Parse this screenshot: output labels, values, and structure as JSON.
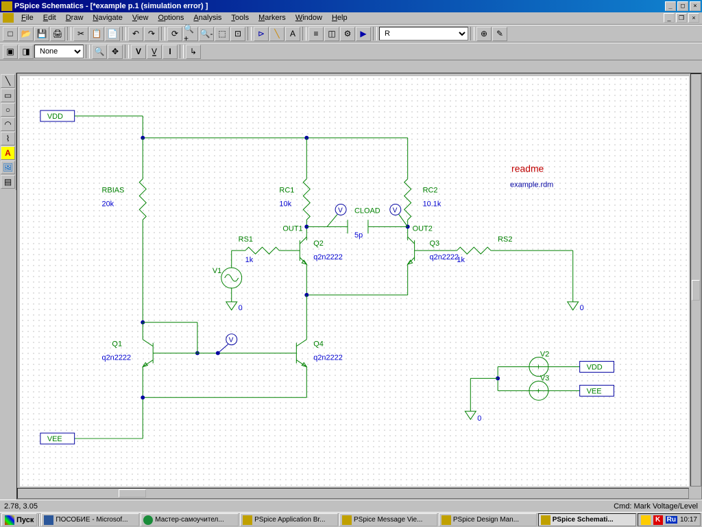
{
  "title": "PSpice Schematics - [*example  p.1  (simulation error) ]",
  "menu": [
    "File",
    "Edit",
    "Draw",
    "Navigate",
    "View",
    "Options",
    "Analysis",
    "Tools",
    "Markers",
    "Window",
    "Help"
  ],
  "toolbar1_combo": "R",
  "toolbar2_combo": "None",
  "schematic": {
    "ports": {
      "vdd1": "VDD",
      "vee1": "VEE",
      "vdd2": "VDD",
      "vee2": "VEE"
    },
    "readme_title": "readme",
    "readme_file": "example.rdm",
    "resistors": {
      "rbias_name": "RBIAS",
      "rbias_val": "20k",
      "rc1_name": "RC1",
      "rc1_val": "10k",
      "rc2_name": "RC2",
      "rc2_val": "10.1k",
      "rs1_name": "RS1",
      "rs1_val": "1k",
      "rs2_name": "RS2",
      "rs2_val": "1k"
    },
    "transistors": {
      "q1_name": "Q1",
      "q1_model": "q2n2222",
      "q2_name": "Q2",
      "q2_model": "q2n2222",
      "q3_name": "Q3",
      "q3_model": "q2n2222",
      "q4_name": "Q4",
      "q4_model": "q2n2222"
    },
    "sources": {
      "v1": "V1",
      "v2": "V2",
      "v3": "V3"
    },
    "cap": {
      "name": "CLOAD",
      "val": "5p"
    },
    "nets": {
      "out1": "OUT1",
      "out2": "OUT2"
    },
    "gnd": {
      "zero": "0"
    }
  },
  "status": {
    "coords": "2.78,  3.05",
    "cmd": "Cmd: Mark Voltage/Level"
  },
  "taskbar": {
    "start": "Пуск",
    "tasks": [
      {
        "label": "ПОСОБИЕ - Microsof...",
        "active": false
      },
      {
        "label": "Мастер-самоучител...",
        "active": false
      },
      {
        "label": "PSpice Application Br...",
        "active": false
      },
      {
        "label": "PSpice Message Vie...",
        "active": false
      },
      {
        "label": "PSpice Design Man...",
        "active": false
      },
      {
        "label": "PSpice Schemati...",
        "active": true
      }
    ],
    "lang": "Ru",
    "clock": "10:17"
  }
}
